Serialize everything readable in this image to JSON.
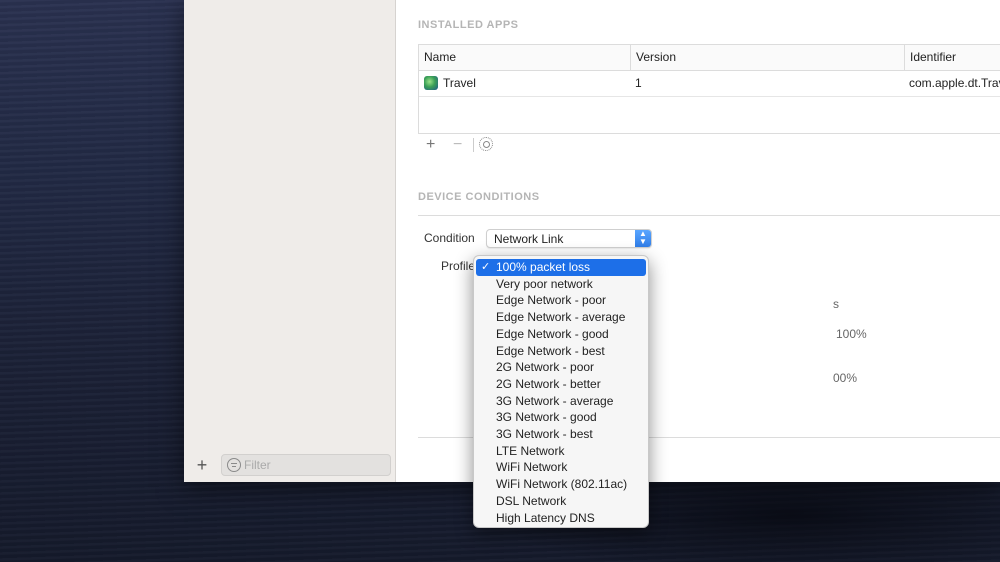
{
  "sidebar": {
    "add_label": "+",
    "filter_placeholder": "Filter"
  },
  "installed_apps": {
    "title": "INSTALLED APPS",
    "columns": [
      "Name",
      "Version",
      "Identifier"
    ],
    "rows": [
      {
        "name": "Travel",
        "version": "1",
        "identifier": "com.apple.dt.Trav",
        "icon": "globe-app-icon"
      }
    ],
    "add_label": "+",
    "remove_label": "−"
  },
  "device_conditions": {
    "title": "DEVICE CONDITIONS",
    "condition_label": "Condition",
    "condition_value": "Network Link",
    "profile_label": "Profile",
    "hidden_fragments": [
      "s",
      "100%",
      "00%"
    ]
  },
  "profile_menu": {
    "selected_index": 0,
    "check_glyph": "✓",
    "items": [
      "100% packet loss",
      "Very poor network",
      "Edge Network - poor",
      "Edge Network - average",
      "Edge Network - good",
      "Edge Network - best",
      "2G Network - poor",
      "2G Network - better",
      "3G Network - average",
      "3G Network - good",
      "3G Network - best",
      "LTE Network",
      "WiFi Network",
      "WiFi Network (802.11ac)",
      "DSL Network",
      "High Latency DNS"
    ]
  },
  "colors": {
    "accent": "#1d6fe8",
    "section_title": "#b5b5b5",
    "sidebar_bg": "#efece9"
  }
}
